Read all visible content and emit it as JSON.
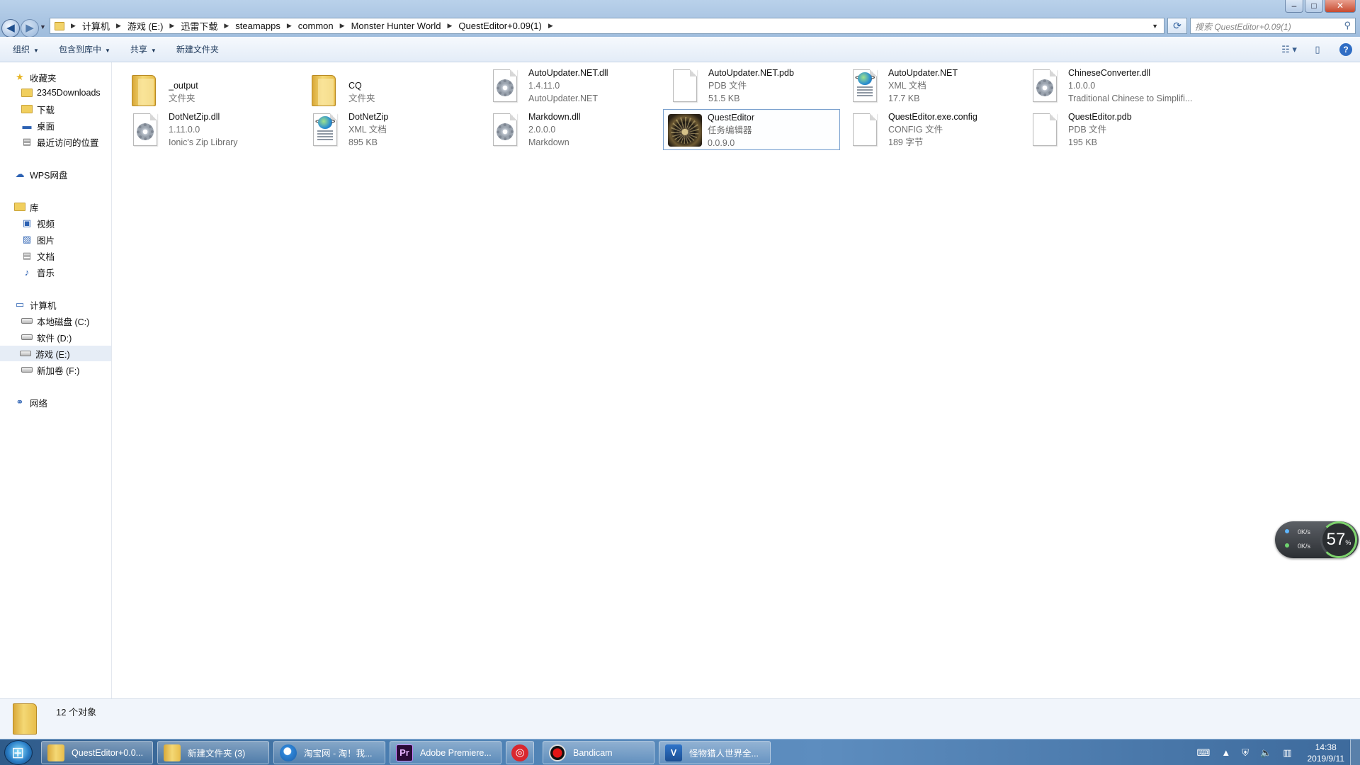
{
  "window": {
    "controls": {
      "minimize": "–",
      "maximize": "□",
      "close": "✕"
    }
  },
  "address_bar": {
    "crumbs": [
      "计算机",
      "游戏 (E:)",
      "迅雷下载",
      "steamapps",
      "common",
      "Monster Hunter World",
      "QuestEditor+0.09(1)"
    ],
    "search_placeholder": "搜索 QuestEditor+0.09(1)"
  },
  "toolbar": {
    "organize": "组织",
    "include_in_library": "包含到库中",
    "share": "共享",
    "new_folder": "新建文件夹"
  },
  "sidebar": {
    "favorites": {
      "label": "收藏夹",
      "items": [
        "2345Downloads",
        "下载",
        "桌面",
        "最近访问的位置"
      ]
    },
    "wps": "WPS网盘",
    "libraries": {
      "label": "库",
      "items": [
        "视频",
        "图片",
        "文档",
        "音乐"
      ]
    },
    "computer": {
      "label": "计算机",
      "items": [
        "本地磁盘 (C:)",
        "软件 (D:)",
        "游戏 (E:)",
        "新加卷 (F:)"
      ],
      "selected": "游戏 (E:)"
    },
    "network": "网络"
  },
  "files": [
    {
      "name": "_output",
      "line2": "文件夹",
      "line3": "",
      "icon": "folder-icon"
    },
    {
      "name": "CQ",
      "line2": "文件夹",
      "line3": "",
      "icon": "folder-icon"
    },
    {
      "name": "AutoUpdater.NET.dll",
      "line2": "1.4.11.0",
      "line3": "AutoUpdater.NET",
      "icon": "dll-icon"
    },
    {
      "name": "AutoUpdater.NET.pdb",
      "line2": "PDB 文件",
      "line3": "51.5 KB",
      "icon": "file-icon"
    },
    {
      "name": "AutoUpdater.NET",
      "line2": "XML 文档",
      "line3": "17.7 KB",
      "icon": "xml-icon"
    },
    {
      "name": "ChineseConverter.dll",
      "line2": "1.0.0.0",
      "line3": "Traditional Chinese to Simplifi...",
      "icon": "dll-icon"
    },
    {
      "name": "DotNetZip.dll",
      "line2": "1.11.0.0",
      "line3": "Ionic's Zip Library",
      "icon": "dll-icon"
    },
    {
      "name": "DotNetZip",
      "line2": "XML 文档",
      "line3": "895 KB",
      "icon": "xml-icon"
    },
    {
      "name": "Markdown.dll",
      "line2": "2.0.0.0",
      "line3": "Markdown",
      "icon": "dll-icon"
    },
    {
      "name": "QuestEditor",
      "line2": "任务编辑器",
      "line3": "0.0.9.0",
      "icon": "app-icon",
      "selected": true
    },
    {
      "name": "QuestEditor.exe.config",
      "line2": "CONFIG 文件",
      "line3": "189 字节",
      "icon": "file-icon"
    },
    {
      "name": "QuestEditor.pdb",
      "line2": "PDB 文件",
      "line3": "195 KB",
      "icon": "file-icon"
    }
  ],
  "status": {
    "count": "12 个对象"
  },
  "net_widget": {
    "up": "0K/s",
    "down": "0K/s",
    "percent": "57",
    "percent_unit": "%"
  },
  "taskbar": {
    "tasks": [
      "QuestEditor+0.0...",
      "新建文件夹 (3)",
      "淘宝网 - 淘！我...",
      "Adobe Premiere...",
      "",
      "Bandicam",
      "怪物猎人世界全..."
    ],
    "clock_time": "14:38",
    "clock_date": "2019/9/11"
  },
  "colors": {
    "accent": "#2f6dc4",
    "selection_border": "#7da2ce"
  }
}
